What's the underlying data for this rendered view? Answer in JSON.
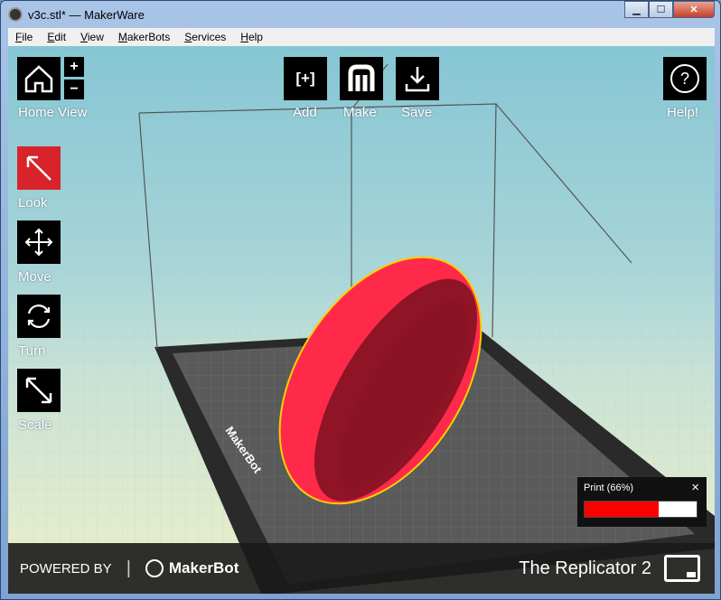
{
  "window": {
    "title": "v3c.stl* — MakerWare",
    "minimize": "▁",
    "maximize": "☐",
    "close": "✕"
  },
  "menu": [
    "File",
    "Edit",
    "View",
    "MakerBots",
    "Services",
    "Help"
  ],
  "toolbar": {
    "home_view": "Home View",
    "zoom_in": "+",
    "zoom_out": "−",
    "add": "Add",
    "add_glyph": "[+]",
    "make": "Make",
    "save": "Save",
    "help": "Help!",
    "help_glyph": "?"
  },
  "tools": [
    {
      "label": "Look",
      "active": true
    },
    {
      "label": "Move"
    },
    {
      "label": "Turn"
    },
    {
      "label": "Scale"
    }
  ],
  "plate_logo": "MakerBot",
  "progress": {
    "label": "Print (66%)",
    "percent": 66,
    "close": "×",
    "color": "#ff0000"
  },
  "footer": {
    "powered_by": "POWERED BY",
    "brand": "MakerBot",
    "printer": "The Replicator 2"
  }
}
